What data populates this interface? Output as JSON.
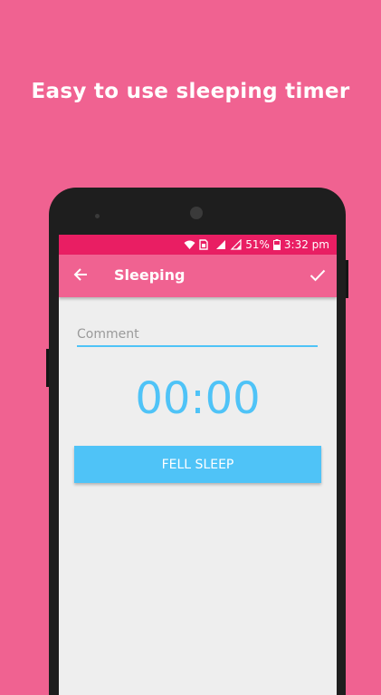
{
  "promo": {
    "headline": "Easy to use sleeping timer"
  },
  "status_bar": {
    "battery": "51%",
    "time": "3:32 pm"
  },
  "app_bar": {
    "back_icon": "arrow-back-icon",
    "title": "Sleeping",
    "confirm_icon": "check-icon"
  },
  "form": {
    "comment_placeholder": "Comment",
    "comment_value": "",
    "timer": "00:00",
    "button_label": "FELL SLEEP"
  },
  "colors": {
    "background": "#f06291",
    "status_bar": "#e91e63",
    "accent": "#4fc3f7",
    "screen_bg": "#eeeeee"
  }
}
